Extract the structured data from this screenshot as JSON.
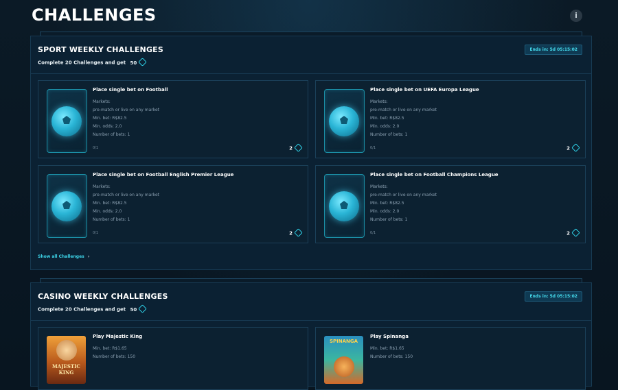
{
  "page": {
    "title": "CHALLENGES",
    "info_icon": "info-icon"
  },
  "sport": {
    "title": "SPORT WEEKLY CHALLENGES",
    "subtitle": "Complete 20 Challenges and get",
    "reward": "50",
    "ends": "Ends in: 5d 05:15:02",
    "show_all": "Show all Challenges",
    "cards": [
      {
        "title": "Place single bet on Football",
        "lines": [
          "Markets:",
          "pre-match or live on any market",
          "Min. bet: R$82.5",
          "Min. odds: 2.0",
          "Number of bets: 1"
        ],
        "progress": "0/1",
        "reward": "2"
      },
      {
        "title": "Place single bet on UEFA Europa League",
        "lines": [
          "Markets:",
          "pre-match or live on any market",
          "Min. bet: R$82.5",
          "Min. odds: 2.0",
          "Number of bets: 1"
        ],
        "progress": "0/1",
        "reward": "2"
      },
      {
        "title": "Place single bet on Football English Premier League",
        "lines": [
          "Markets:",
          "pre-match or live on any market",
          "Min. bet: R$82.5",
          "Min. odds: 2.0",
          "Number of bets: 1"
        ],
        "progress": "0/1",
        "reward": "2"
      },
      {
        "title": "Place single bet on Football Champions League",
        "lines": [
          "Markets:",
          "pre-match or live on any market",
          "Min. bet: R$82.5",
          "Min. odds: 2.0",
          "Number of bets: 1"
        ],
        "progress": "0/1",
        "reward": "2"
      }
    ]
  },
  "casino": {
    "title": "CASINO WEEKLY CHALLENGES",
    "subtitle": "Complete 20 Challenges and get",
    "reward": "50",
    "ends": "Ends in: 5d 05:15:02",
    "cards": [
      {
        "title": "Play Majestic King",
        "lines": [
          "Min. bet: R$1.65",
          "Number of bets: 150"
        ],
        "art_text": "MAJESTIC KING"
      },
      {
        "title": "Play Spinanga",
        "lines": [
          "Min. bet: R$1.65",
          "Number of bets: 150"
        ],
        "art_text": "SPINANGA"
      }
    ]
  },
  "colors": {
    "accent": "#3ed6ea",
    "panel": "#0b2133",
    "background": "#081520"
  }
}
